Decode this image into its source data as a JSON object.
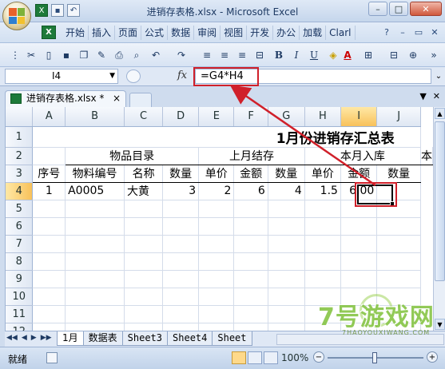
{
  "window": {
    "title": "进销存表格.xlsx - Microsoft Excel"
  },
  "ribbon": {
    "tabs": [
      "开始",
      "插入",
      "页面",
      "公式",
      "数据",
      "审阅",
      "视图",
      "开发",
      "办公",
      "加载",
      "Clarl"
    ]
  },
  "formula_bar": {
    "name_box": "I4",
    "fx_label": "fx",
    "formula": "=G4*H4"
  },
  "workbook_tab": {
    "label": "进销存表格.xlsx *",
    "close": "×"
  },
  "grid": {
    "columns": [
      "A",
      "B",
      "C",
      "D",
      "E",
      "F",
      "G",
      "H",
      "I",
      "J"
    ],
    "rows": [
      "1",
      "2",
      "3",
      "4",
      "5",
      "6",
      "7",
      "8",
      "9",
      "10",
      "11",
      "12"
    ],
    "title": "1月份进销存汇总表",
    "groups": {
      "material_dir": "物品目录",
      "last_month": "上月结存",
      "this_month_in": "本月入库",
      "next_partial": "本"
    },
    "headers": {
      "seq": "序号",
      "code": "物料编号",
      "name": "名称",
      "qty1": "数量",
      "price1": "单价",
      "amt1": "金额",
      "qty2": "数量",
      "price2": "单价",
      "amt2": "金额",
      "qty3": "数量"
    },
    "row4": {
      "seq": "1",
      "code": "A0005",
      "name": "大黄",
      "qty1": "3",
      "price1": "2",
      "amt1": "6",
      "qty2": "4",
      "price2": "1.5",
      "amt2": "6.00"
    }
  },
  "sheets": {
    "nav": [
      "◀◀",
      "◀",
      "▶",
      "▶▶"
    ],
    "tabs": [
      "1月",
      "数据表",
      "Sheet3",
      "Sheet4",
      "Sheet"
    ]
  },
  "status": {
    "ready": "就绪",
    "zoom": "100%",
    "minus": "−",
    "plus": "+"
  },
  "watermark": {
    "text": "7号游戏网",
    "sub": "7HAOYOUXIWANG.COM"
  },
  "colors": {
    "highlight_red": "#d0202a",
    "excel_green": "#1d7a3a",
    "selected_header": "#f8c15a"
  }
}
